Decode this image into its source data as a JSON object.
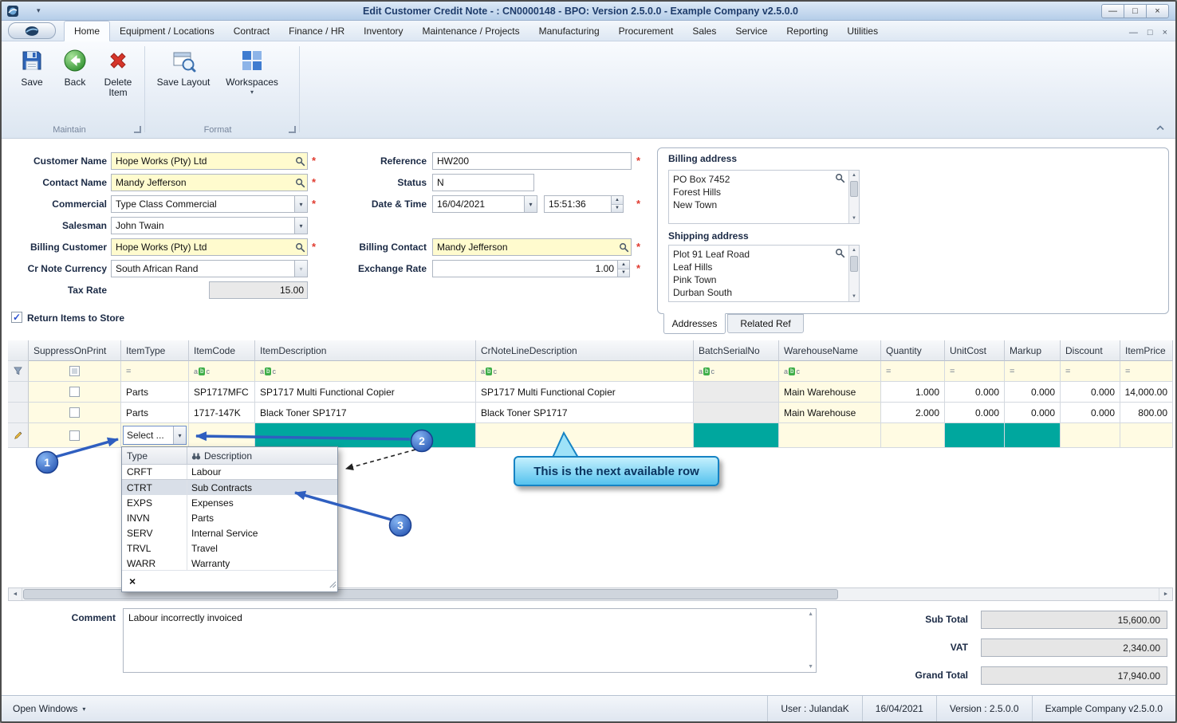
{
  "window": {
    "title": "Edit Customer Credit Note - : CN0000148 - BPO: Version 2.5.0.0 - Example Company v2.5.0.0"
  },
  "colors": {
    "mandatory_cell_teal": "#00a79e",
    "required_red": "#e03a2f",
    "annotation_blue": "#2f5fc0",
    "bubble_blue": "#55c2ee",
    "lookup_field_yellow": "#fffbce"
  },
  "icons": {
    "qat_caret": "▾",
    "minimize": "—",
    "maximize": "□",
    "close": "×",
    "mdi_minimize": "—",
    "mdi_restore": "□",
    "mdi_close": "×",
    "dropdown_caret": "▾",
    "spin_up": "▲",
    "spin_down": "▼",
    "scroll_up": "▲",
    "scroll_down": "▼",
    "scroll_left": "◄",
    "scroll_right": "►",
    "check": "✓",
    "equals": "=",
    "abc_a": "a",
    "abc_b": "b",
    "abc_c": "c",
    "clear_filter": "×",
    "open_windows_caret": "▾"
  },
  "ribbon": {
    "tabs": [
      "Home",
      "Equipment / Locations",
      "Contract",
      "Finance / HR",
      "Inventory",
      "Maintenance / Projects",
      "Manufacturing",
      "Procurement",
      "Sales",
      "Service",
      "Reporting",
      "Utilities"
    ],
    "buttons": {
      "save": "Save",
      "back": "Back",
      "delete_item": "Delete Item",
      "save_layout": "Save Layout",
      "workspaces": "Workspaces"
    },
    "groups": {
      "maintain": "Maintain",
      "format": "Format"
    }
  },
  "form": {
    "customer_name": {
      "label": "Customer Name",
      "value": "Hope Works (Pty) Ltd",
      "required": "*"
    },
    "contact_name": {
      "label": "Contact Name",
      "value": "Mandy Jefferson",
      "required": "*"
    },
    "commercial": {
      "label": "Commercial",
      "value": "Type Class Commercial",
      "required": "*"
    },
    "salesman": {
      "label": "Salesman",
      "value": "John Twain"
    },
    "billing_customer": {
      "label": "Billing Customer",
      "value": "Hope Works (Pty) Ltd",
      "required": "*"
    },
    "cr_note_currency": {
      "label": "Cr Note Currency",
      "value": "South African Rand"
    },
    "tax_rate": {
      "label": "Tax Rate",
      "value": "15.00"
    },
    "reference": {
      "label": "Reference",
      "value": "HW200",
      "required": "*"
    },
    "status": {
      "label": "Status",
      "value": "N"
    },
    "date_time": {
      "label": "Date & Time",
      "date": "16/04/2021",
      "time": "15:51:36",
      "required": "*"
    },
    "billing_contact": {
      "label": "Billing Contact",
      "value": "Mandy Jefferson",
      "required": "*"
    },
    "exchange_rate": {
      "label": "Exchange Rate",
      "value": "1.00",
      "required": "*"
    },
    "return_items": {
      "label": "Return Items to Store"
    }
  },
  "addresses": {
    "billing_title": "Billing address",
    "billing_lines": "PO Box 7452\nForest Hills\nNew Town",
    "shipping_title": "Shipping address",
    "shipping_lines": "Plot 91 Leaf Road\nLeaf Hills\nPink Town\nDurban South",
    "tab_addresses": "Addresses",
    "tab_related_ref": "Related Ref"
  },
  "grid": {
    "columns": [
      "SuppressOnPrint",
      "ItemType",
      "ItemCode",
      "ItemDescription",
      "CrNoteLineDescription",
      "BatchSerialNo",
      "WarehouseName",
      "Quantity",
      "UnitCost",
      "Markup",
      "Discount",
      "ItemPrice"
    ],
    "rows": [
      {
        "item_type": "Parts",
        "item_code": "SP1717MFC",
        "item_description": "SP1717 Multi Functional Copier",
        "crnote_line_description": "SP1717 Multi Functional Copier",
        "batch_serial_no": "",
        "warehouse_name": "Main Warehouse",
        "quantity": "1.000",
        "unit_cost": "0.000",
        "markup": "0.000",
        "discount": "0.000",
        "item_price": "14,000.00"
      },
      {
        "item_type": "Parts",
        "item_code": "1717-147K",
        "item_description": "Black Toner SP1717",
        "crnote_line_description": "Black Toner SP1717",
        "batch_serial_no": "",
        "warehouse_name": "Main Warehouse",
        "quantity": "2.000",
        "unit_cost": "0.000",
        "markup": "0.000",
        "discount": "0.000",
        "item_price": "800.00"
      }
    ],
    "edit_row": {
      "item_type_editor": "Select ..."
    }
  },
  "type_lookup": {
    "header_type": "Type",
    "header_description": "Description",
    "rows": [
      {
        "code": "CRFT",
        "description": "Labour"
      },
      {
        "code": "CTRT",
        "description": "Sub Contracts"
      },
      {
        "code": "EXPS",
        "description": "Expenses"
      },
      {
        "code": "INVN",
        "description": "Parts"
      },
      {
        "code": "SERV",
        "description": "Internal Service"
      },
      {
        "code": "TRVL",
        "description": "Travel"
      },
      {
        "code": "WARR",
        "description": "Warranty"
      }
    ]
  },
  "annotations": {
    "step1": "1",
    "step2": "2",
    "step3": "3",
    "bubble": "This is the next available row"
  },
  "comment": {
    "label": "Comment",
    "value": "Labour incorrectly invoiced"
  },
  "totals": {
    "sub_total_label": "Sub Total",
    "sub_total": "15,600.00",
    "vat_label": "VAT",
    "vat": "2,340.00",
    "grand_total_label": "Grand Total",
    "grand_total": "17,940.00"
  },
  "statusbar": {
    "open_windows": "Open Windows",
    "user": "User : JulandaK",
    "date": "16/04/2021",
    "version": "Version : 2.5.0.0",
    "company": "Example Company v2.5.0.0"
  }
}
